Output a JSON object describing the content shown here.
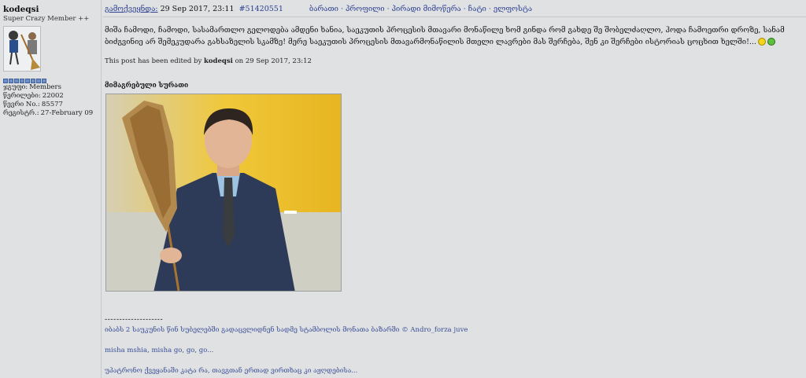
{
  "user": {
    "name": "kodeqsi",
    "title": "Super Crazy Member ++",
    "rank_pips": 8,
    "stats": [
      {
        "label": "ჯგუფი:",
        "value": "Members"
      },
      {
        "label": "წერილები:",
        "value": "22002"
      },
      {
        "label": "წევრი No.:",
        "value": "85577"
      },
      {
        "label": "რეგისტრ.:",
        "value": "27-February 09"
      }
    ]
  },
  "post": {
    "posted_label": "გამოქვეყნდა:",
    "date": "29 Sep 2017, 23:11",
    "id": "#51420551",
    "links": "ბარათი · პროფილი · პირადი მიმოწერა · ჩატი · ელფოსტა",
    "message": "მიშა ჩამოდი, ჩამოდი, სასამართლო გელოდება ამდენი ხანია, საეკუთის პროცესის მთავარი მონაწილე ხომ გინდა რომ გახდე შე შობელძაღლო, ჰოდა ჩამოეთრი დროზე, სანამ ბიძგვინიე არ შემეკუდარა გახსაზელის სკამზე! მერე საეკუთის პროცესის მთავარმონაწილის მთელი ლავრები მას შერჩება, შენ კი შერჩები ისტორიას ცოცხით ხელში!...",
    "edited": {
      "prefix": "This post has been edited by",
      "user": "kodeqsi",
      "suffix": "on 29 Sep 2017, 23:12"
    },
    "attachment_title": "მიმაგრებული სურათი"
  },
  "signature": {
    "divider": "--------------------",
    "lines": [
      "იბაბს 2 საუკუნის წინ სუბელებში გადაცვლიდნენ სადმე სტამბოლის მონათა ბაზარში © Andro_forza juve",
      "misha mshia, misha go, go, go...",
      "უპატრონო ქვეყანაში კატა რა, თავგთან ერთად ვირთხაც კი აჟღდებისა..."
    ]
  },
  "colors": {
    "link": "#2a3d8f",
    "background": "#dfe1e3",
    "pip": "#6f8fc8"
  }
}
